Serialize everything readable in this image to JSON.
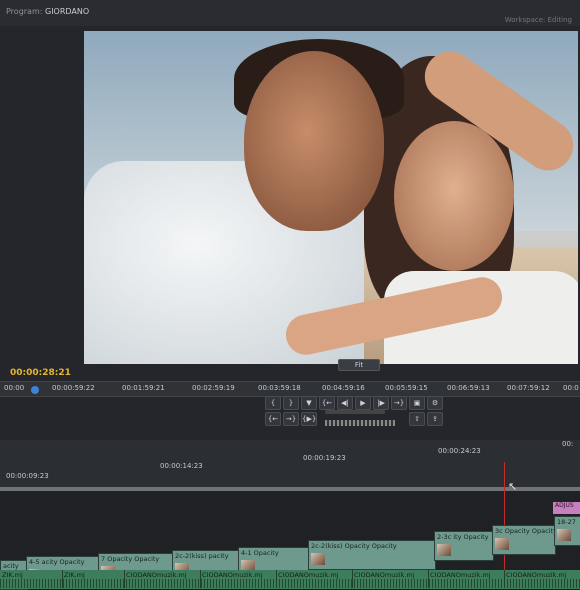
{
  "topbar": {
    "project_label": "Program:",
    "project_name": "GIORDANO",
    "workspace_label": "Workspace:",
    "workspace_value": "Editing"
  },
  "monitor": {
    "zoom": "Fit",
    "timecode": "00:00:28:21",
    "ruler_ticks": [
      "00:00",
      "00:00:59:22",
      "00:01:59:21",
      "00:02:59:19",
      "00:03:59:18",
      "00:04:59:16",
      "00:05:59:15",
      "00:06:59:13",
      "00:07:59:12",
      "00:0"
    ]
  },
  "timeline": {
    "ruler_ticks": [
      "00:00:09:23",
      "00:00:14:23",
      "00:00:19:23",
      "00:00:24:23",
      "00:"
    ],
    "clips": [
      {
        "label": "acity"
      },
      {
        "label": "4-5 acity Opacity"
      },
      {
        "label": "7 Opacity Opacity"
      },
      {
        "label": "2c-2(kiss) pacity"
      },
      {
        "label": "4-1 Opacity"
      },
      {
        "label": "2c-2(kiss) Opacity Opacity"
      },
      {
        "label": "2-3c ity Opacity"
      },
      {
        "label": "3c Opacity Opacity"
      },
      {
        "label": "18-27"
      }
    ],
    "audio_clips": [
      "ZIK.mj",
      "ZIK.mj",
      "CIODANOmuzik.mj",
      "CIODANOmuzik.mj",
      "CIODANOmuzik.mj",
      "CIODANOmuzik.mj",
      "CIODANOmuzik.mj",
      "CIODANOmuzik.mj"
    ],
    "magenta_clip": "ADJUS"
  }
}
